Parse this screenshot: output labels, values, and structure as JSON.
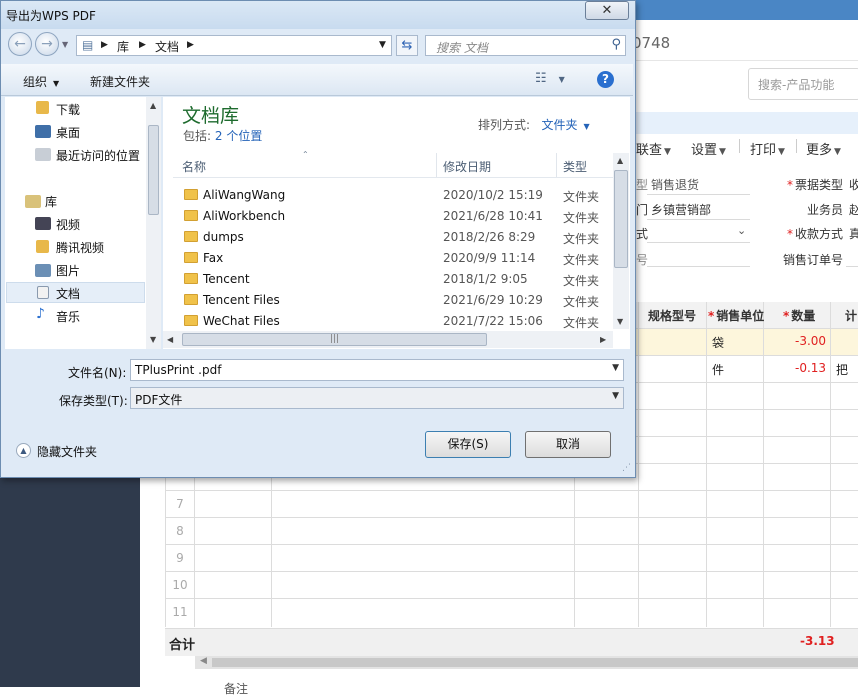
{
  "background_app": {
    "address_suffix": "0748",
    "search_placeholder": "搜索-产品功能",
    "menu": [
      "联查",
      "设置",
      "打印",
      "更多"
    ],
    "form": {
      "voucher_label_tail": "型",
      "voucher_value": "销售退货",
      "dept_label_tail": "门",
      "dept_value": "乡镇营销部",
      "third_label_tail": "式",
      "fourth_label_tail": "号",
      "ticket_type_label": "票据类型",
      "ticket_type_value": "收",
      "salesman_label": "业务员",
      "salesman_value": "赵",
      "payment_label": "收款方式",
      "payment_value": "真",
      "sales_order_label": "销售订单号"
    },
    "grid": {
      "headers": [
        "规格型号",
        "销售单位",
        "数量",
        "计"
      ],
      "rows": [
        {
          "unit": "袋",
          "qty": "-3.00",
          "extra": ""
        },
        {
          "unit": "件",
          "qty": "-0.13",
          "extra": "把"
        }
      ],
      "row_numbers": [
        "7",
        "8",
        "9",
        "10",
        "11"
      ],
      "total_label": "合计",
      "total_value": "-3.13"
    },
    "remark_label": "备注"
  },
  "dialog": {
    "title": "导出为WPS PDF",
    "breadcrumb": [
      "库",
      "文档"
    ],
    "search_placeholder": "搜索 文档",
    "toolbar": {
      "organize": "组织",
      "new_folder": "新建文件夹"
    },
    "nav": {
      "favorites": [
        "下载",
        "桌面",
        "最近访问的位置"
      ],
      "libraries_header": "库",
      "libraries": [
        "视频",
        "腾讯视频",
        "图片",
        "文档",
        "音乐"
      ]
    },
    "library": {
      "title": "文档库",
      "includes_label": "包括:",
      "includes_link": "2 个位置",
      "arrange_label": "排列方式:",
      "arrange_value": "文件夹"
    },
    "columns": {
      "name": "名称",
      "date": "修改日期",
      "type": "类型"
    },
    "files": [
      {
        "name": "AliWangWang",
        "date": "2020/10/2 15:19",
        "type": "文件夹"
      },
      {
        "name": "AliWorkbench",
        "date": "2021/6/28 10:41",
        "type": "文件夹"
      },
      {
        "name": "dumps",
        "date": "2018/2/26 8:29",
        "type": "文件夹"
      },
      {
        "name": "Fax",
        "date": "2020/9/9 11:14",
        "type": "文件夹"
      },
      {
        "name": "Tencent",
        "date": "2018/1/2 9:05",
        "type": "文件夹"
      },
      {
        "name": "Tencent Files",
        "date": "2021/6/29 10:29",
        "type": "文件夹"
      },
      {
        "name": "WeChat Files",
        "date": "2021/7/22 15:06",
        "type": "文件夹"
      }
    ],
    "filename_label": "文件名(N):",
    "filename_value": "TPlusPrint .pdf",
    "filetype_label": "保存类型(T):",
    "filetype_value": "PDF文件",
    "hide_folders": "隐藏文件夹",
    "save_button": "保存(S)",
    "cancel_button": "取消"
  }
}
